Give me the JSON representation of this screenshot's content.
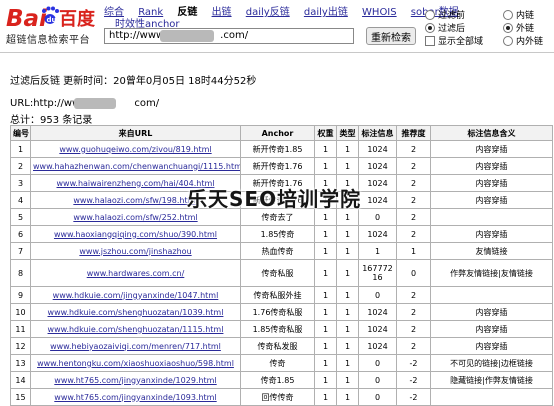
{
  "header": {
    "logo_text_left": "Bai",
    "logo_text_right": "百度",
    "logo_subtitle": "超链信息检索平台",
    "nav": [
      {
        "label": "综合",
        "active": false
      },
      {
        "label": "Rank",
        "active": false
      },
      {
        "label": "反链",
        "active": true
      },
      {
        "label": "出链",
        "active": false
      },
      {
        "label": "daily反链",
        "active": false
      },
      {
        "label": "daily出链",
        "active": false
      },
      {
        "label": "WHOIS",
        "active": false
      },
      {
        "label": "sobar数据",
        "active": false
      }
    ],
    "nav_sub": "时效性anchor",
    "url_value": "http://www",
    "url_suffix": ".com/",
    "search_button": "重新检索",
    "filter_options": [
      "过滤前",
      "过滤后",
      "显示全部域"
    ],
    "scope_options": [
      "内链",
      "外链",
      "内外链"
    ]
  },
  "meta": {
    "filter_time": "过滤后反链  更新时间：20曾年0月05日  18时44分52秒",
    "url_label": "URL:http://www",
    "url_suffix": "com/",
    "total": "总计：953 条记录"
  },
  "table": {
    "headers": [
      "编号",
      "来自URL",
      "Anchor",
      "权重",
      "类型",
      "标注信息",
      "推荐度",
      "标注信息含义"
    ],
    "rows": [
      [
        "1",
        "www.guohuqeiwo.com/zivou/819.html",
        "新开传奇1.85",
        "1",
        "1",
        "1024",
        "2",
        "内容穿插"
      ],
      [
        "2",
        "www.hahazhenwan.com/chenwanchuangi/1115.html",
        "新开传奇1.76",
        "1",
        "1",
        "1024",
        "2",
        "内容穿插"
      ],
      [
        "3",
        "www.haiwairenzheng.com/hai/404.html",
        "新开传奇1.76",
        "1",
        "1",
        "1024",
        "2",
        "内容穿插"
      ],
      [
        "4",
        "www.halaozi.com/sfw/198.html",
        "新开传奇1.76",
        "1",
        "1",
        "1024",
        "2",
        "内容穿插"
      ],
      [
        "5",
        "www.halaozi.com/sfw/252.html",
        "传奇去了",
        "1",
        "1",
        "0",
        "2",
        ""
      ],
      [
        "6",
        "www.haoxiangqiqing.com/shuo/390.html",
        "1.85传奇",
        "1",
        "1",
        "1024",
        "2",
        "内容穿插"
      ],
      [
        "7",
        "www.jszhou.com/jinshazhou",
        "热血传奇",
        "1",
        "1",
        "1",
        "1",
        "友情链接"
      ],
      [
        "8",
        "www.hardwares.com.cn/",
        "传奇私服",
        "1",
        "1",
        "16777216",
        "0",
        "作弊友情链接|友情链接"
      ],
      [
        "9",
        "www.hdkuie.com/jingyanxinde/1047.html",
        "传奇私服外挂",
        "1",
        "1",
        "0",
        "2",
        ""
      ],
      [
        "10",
        "www.hdkuie.com/shenghuozatan/1039.html",
        "1.76传奇私服",
        "1",
        "1",
        "1024",
        "2",
        "内容穿插"
      ],
      [
        "11",
        "www.hdkuie.com/shenghuozatan/1115.html",
        "1.85传奇私服",
        "1",
        "1",
        "1024",
        "2",
        "内容穿插"
      ],
      [
        "12",
        "www.hebiyaozaiviqi.com/menren/717.html",
        "传奇私发服",
        "1",
        "1",
        "1024",
        "2",
        "内容穿插"
      ],
      [
        "13",
        "www.hentongku.com/xiaoshuoxiaoshuo/598.html",
        "传奇",
        "1",
        "1",
        "0",
        "-2",
        "不可见的链接|边框链接"
      ],
      [
        "14",
        "www.ht765.com/jingyanxinde/1029.html",
        "传奇1.85",
        "1",
        "1",
        "0",
        "-2",
        "隐藏链接|作弊友情链接"
      ],
      [
        "15",
        "www.ht765.com/jingyanxinde/1093.html",
        "回传传奇",
        "1",
        "1",
        "0",
        "-2",
        ""
      ]
    ]
  },
  "watermark": "乐天SEO培训学院",
  "colors": {
    "logo_red": "#d9231d",
    "logo_blue": "#2932e1",
    "link": "#2a2a9a"
  }
}
